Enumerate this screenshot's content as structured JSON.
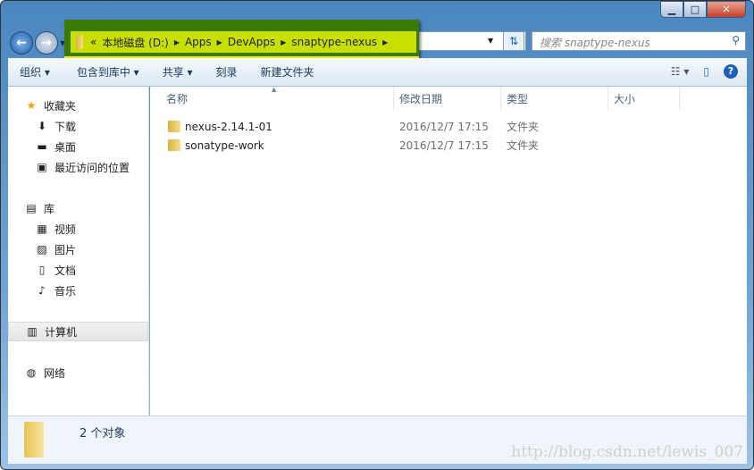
{
  "window": {
    "controls": {
      "minimize": "▁",
      "maximize": "□",
      "close": "✕"
    }
  },
  "address": {
    "overflow": "«",
    "crumbs": [
      "本地磁盘 (D:)",
      "Apps",
      "DevApps",
      "snaptype-nexus"
    ],
    "highlight_color": "#c8e000"
  },
  "search": {
    "placeholder": "搜索 snaptype-nexus"
  },
  "toolbar": {
    "items": [
      "组织 ▾",
      "包含到库中 ▾",
      "共享 ▾",
      "刻录",
      "新建文件夹"
    ],
    "help": "?"
  },
  "sidebar": {
    "items": [
      {
        "label": "收藏夹",
        "icon": "star-icon",
        "glyph": "★"
      },
      {
        "label": "下载",
        "icon": "download-icon",
        "glyph": "⬇"
      },
      {
        "label": "桌面",
        "icon": "desktop-icon",
        "glyph": "▬"
      },
      {
        "label": "最近访问的位置",
        "icon": "recent-icon",
        "glyph": "▣"
      },
      {
        "label": "库",
        "icon": "library-icon",
        "glyph": "▤"
      },
      {
        "label": "视频",
        "icon": "video-icon",
        "glyph": "▦"
      },
      {
        "label": "图片",
        "icon": "picture-icon",
        "glyph": "▨"
      },
      {
        "label": "文档",
        "icon": "document-icon",
        "glyph": "▯"
      },
      {
        "label": "音乐",
        "icon": "music-icon",
        "glyph": "♪"
      },
      {
        "label": "计算机",
        "icon": "computer-icon",
        "glyph": "▥"
      },
      {
        "label": "网络",
        "icon": "network-icon",
        "glyph": "◍"
      }
    ]
  },
  "columns": [
    "名称",
    "修改日期",
    "类型",
    "大小"
  ],
  "files": [
    {
      "name": "nexus-2.14.1-01",
      "date": "2016/12/7 17:15",
      "type": "文件夹"
    },
    {
      "name": "sonatype-work",
      "date": "2016/12/7 17:15",
      "type": "文件夹"
    }
  ],
  "status": {
    "count": "2 个对象"
  },
  "watermark": "http://blog.csdn.net/lewis_007"
}
